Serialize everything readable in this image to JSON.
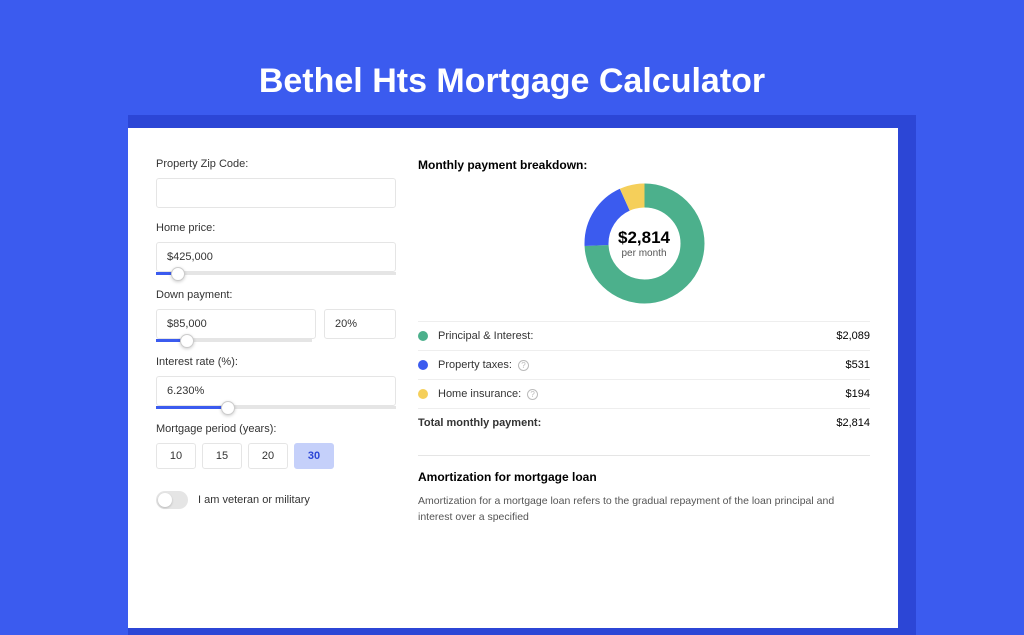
{
  "page_title": "Bethel Hts Mortgage Calculator",
  "form": {
    "zip": {
      "label": "Property Zip Code:",
      "value": ""
    },
    "home_price": {
      "label": "Home price:",
      "value": "$425,000",
      "slider_pct": 9
    },
    "down_payment": {
      "label": "Down payment:",
      "amount": "$85,000",
      "pct": "20%",
      "slider_pct": 20
    },
    "interest": {
      "label": "Interest rate (%):",
      "value": "6.230%",
      "slider_pct": 30
    },
    "period": {
      "label": "Mortgage period (years):",
      "options": [
        "10",
        "15",
        "20",
        "30"
      ],
      "selected": "30"
    },
    "veteran": {
      "label": "I am veteran or military",
      "checked": false
    }
  },
  "breakdown": {
    "title": "Monthly payment breakdown:",
    "donut": {
      "big": "$2,814",
      "small": "per month"
    },
    "segments": [
      {
        "key": "pi",
        "label": "Principal & Interest:",
        "value": "$2,089",
        "pct": 74.2,
        "color": "#4cb08c",
        "info": false
      },
      {
        "key": "tax",
        "label": "Property taxes:",
        "value": "$531",
        "pct": 18.9,
        "color": "#3b5bef",
        "info": true
      },
      {
        "key": "ins",
        "label": "Home insurance:",
        "value": "$194",
        "pct": 6.9,
        "color": "#f5cf5a",
        "info": true
      }
    ],
    "total": {
      "label": "Total monthly payment:",
      "value": "$2,814"
    }
  },
  "amortization": {
    "title": "Amortization for mortgage loan",
    "body": "Amortization for a mortgage loan refers to the gradual repayment of the loan principal and interest over a specified"
  },
  "chart_data": {
    "type": "pie",
    "title": "Monthly payment breakdown",
    "categories": [
      "Principal & Interest",
      "Property taxes",
      "Home insurance"
    ],
    "values": [
      2089,
      531,
      194
    ],
    "total": 2814,
    "unit": "$ per month",
    "colors": [
      "#4cb08c",
      "#3b5bef",
      "#f5cf5a"
    ]
  }
}
